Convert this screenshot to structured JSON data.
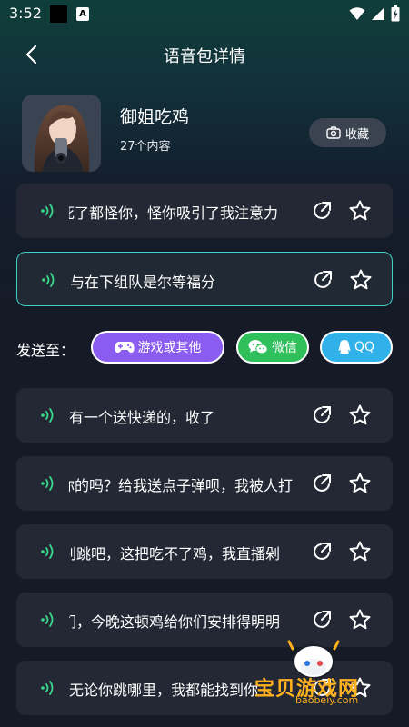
{
  "status_bar": {
    "time": "3:52",
    "app_icon_letter": "A"
  },
  "header": {
    "title": "语音包详情"
  },
  "pack": {
    "name": "御姐吃鸡",
    "count_text": "27个内容",
    "collect_label": "收藏"
  },
  "send": {
    "label": "发送至：",
    "game_label": "游戏或其他",
    "wechat_label": "微信",
    "qq_label": "QQ"
  },
  "voices": [
    {
      "text": "死了都怪你，怪你吸引了我注意力",
      "selected": false
    },
    {
      "text": "与在下组队是尔等福分",
      "selected": true
    },
    {
      "text": "有一个送快递的，收了",
      "selected": false
    },
    {
      "text": "你的吗？给我送点子弹呗，我被人打",
      "selected": false
    },
    {
      "text": "别跳吧，这把吃不了鸡，我直播剁",
      "selected": false
    },
    {
      "text": "们，今晚这顿鸡给你们安排得明明",
      "selected": false
    },
    {
      "text": "无论你跳哪里，我都能找到你",
      "selected": false
    }
  ],
  "watermark": {
    "brand": "宝贝游戏网",
    "url": "baobeiy.com"
  },
  "colors": {
    "accent_teal": "#3fd1c7",
    "wave_green": "#3ad88a",
    "game_purple": "#8a5cf0",
    "wechat_green": "#2fc05c",
    "qq_blue": "#31b1e9",
    "card_bg": "#232834",
    "watermark_orange": "#ffb21e"
  }
}
